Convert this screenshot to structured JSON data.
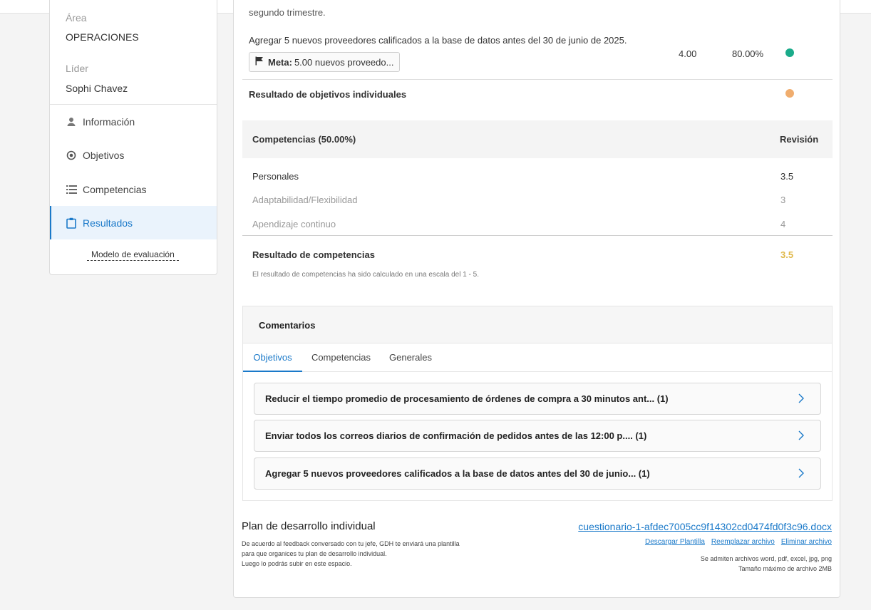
{
  "sidebar": {
    "area_label": "Área",
    "area_value": "OPERACIONES",
    "leader_label": "Líder",
    "leader_value": "Sophi Chavez",
    "items": [
      {
        "label": "Información",
        "icon": "user-icon"
      },
      {
        "label": "Objetivos",
        "icon": "target-icon"
      },
      {
        "label": "Competencias",
        "icon": "list-icon"
      },
      {
        "label": "Resultados",
        "icon": "clipboard-icon",
        "active": true
      }
    ],
    "model_link": "Modelo de evaluación"
  },
  "objectives": {
    "partial_text": "segundo trimestre.",
    "last_objective": "Agregar 5 nuevos proveedores calificados a la base de datos antes del 30 de junio de 2025.",
    "meta_label": "Meta:",
    "meta_value": "5.00 nuevos proveedo...",
    "score": "4.00",
    "percent": "80.00%",
    "status_color": "#1aab8a",
    "result_label": "Resultado de objetivos individuales",
    "result_color": "#f0ad6e"
  },
  "competencies": {
    "header": "Competencias (50.00%)",
    "review_header": "Revisión",
    "rows": [
      {
        "name": "Personales",
        "value": "3.5"
      },
      {
        "name": "Adaptabilidad/Flexibilidad",
        "value": "3"
      },
      {
        "name": "Apendizaje continuo",
        "value": "4"
      }
    ],
    "result_label": "Resultado de competencias",
    "result_value": "3.5",
    "result_color": "#e0b84a",
    "note": "El resultado de competencias ha sido calculado en una escala del 1 - 5."
  },
  "comments": {
    "title": "Comentarios",
    "tabs": [
      "Objetivos",
      "Competencias",
      "Generales"
    ],
    "active_tab": "Objetivos",
    "items": [
      "Reducir el tiempo promedio de procesamiento de órdenes de compra a 30 minutos ant... (1)",
      "Enviar todos los correos diarios de confirmación de pedidos antes de las 12:00 p.... (1)",
      "Agregar 5 nuevos proveedores calificados a la base de datos antes del 30 de junio... (1)"
    ]
  },
  "plan": {
    "title": "Plan de desarrollo individual",
    "description": [
      "De acuerdo al feedback conversado con tu jefe, GDH te enviará una plantilla",
      "para que organices tu plan de desarrollo individual.",
      "Luego lo podrás subir en este espacio."
    ],
    "file_name": "cuestionario-1-afdec7005cc9f14302cd0474fd0f3c96.docx",
    "actions": [
      "Descargar Plantilla",
      "Reemplazar archivo",
      "Eliminar archivo"
    ],
    "allowed": "Se admiten archivos word, pdf, excel, jpg, png",
    "max_size": "Tamaño máximo de archivo 2MB"
  }
}
